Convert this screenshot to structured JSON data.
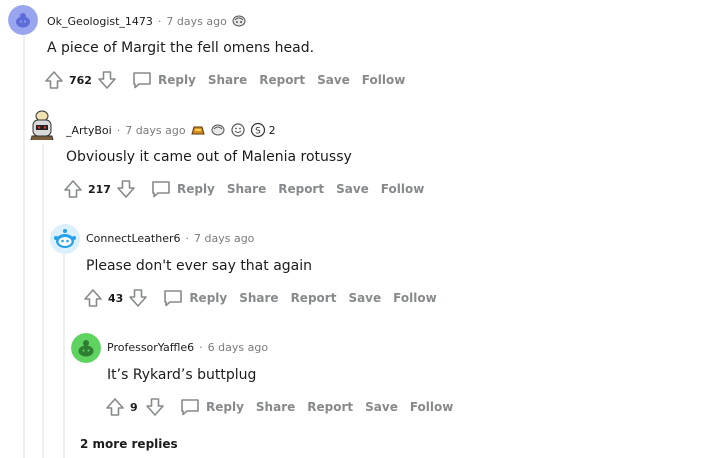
{
  "comments": [
    {
      "user": "Ok_Geologist_1473",
      "time": "7 days ago",
      "body": "A piece of Margit the fell omens head.",
      "score": "762",
      "award_count": ""
    },
    {
      "user": "_ArtyBoi",
      "time": "7 days ago",
      "body": "Obviously it came out of Malenia rotussy",
      "score": "217",
      "award_count": "2"
    },
    {
      "user": "ConnectLeather6",
      "time": "7 days ago",
      "body": "Please don't ever say that again",
      "score": "43",
      "award_count": ""
    },
    {
      "user": "ProfessorYaffle6",
      "time": "6 days ago",
      "body": "It’s Rykard’s buttplug",
      "score": "9",
      "award_count": ""
    }
  ],
  "actions": {
    "reply": "Reply",
    "share": "Share",
    "report": "Report",
    "save": "Save",
    "follow": "Follow"
  },
  "separator": "·",
  "more_replies": "2 more replies",
  "colors": {
    "text": "#1c1c1c",
    "muted": "#7c7c7c",
    "action": "#878a8c",
    "thread_line": "#edeff1",
    "avatar_purple": "#9aa5f0",
    "avatar_blue": "#24a0ed",
    "avatar_green": "#5fd35f"
  },
  "icons": {
    "upvote": "arrow-up-icon",
    "downvote": "arrow-down-icon",
    "reply": "speech-bubble-icon",
    "award": "award-icon"
  }
}
